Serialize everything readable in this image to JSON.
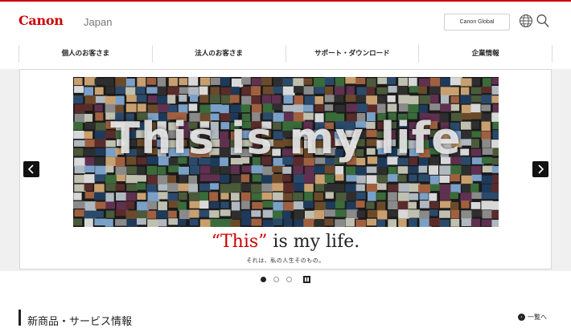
{
  "header": {
    "logo_text": "Canon",
    "region": "Japan",
    "global_button": "Canon Global",
    "accent": "#cc0000"
  },
  "nav": {
    "items": [
      {
        "label": "個人のお客さま"
      },
      {
        "label": "法人のお客さま"
      },
      {
        "label": "サポート・ダウンロード"
      },
      {
        "label": "企業情報"
      }
    ]
  },
  "hero": {
    "collage_text": "This is my life",
    "headline_open_quote": "“",
    "headline_red": "This",
    "headline_close_quote": "”",
    "headline_rest": " is my life.",
    "subline": "それは、私の人生そのもの。",
    "prev_icon": "chevron-left-icon",
    "next_icon": "chevron-right-icon",
    "pause_icon": "pause-icon",
    "slide_count": 3,
    "active_slide": 1
  },
  "section": {
    "title": "新商品・サービス情報",
    "list_link": "一覧へ"
  }
}
